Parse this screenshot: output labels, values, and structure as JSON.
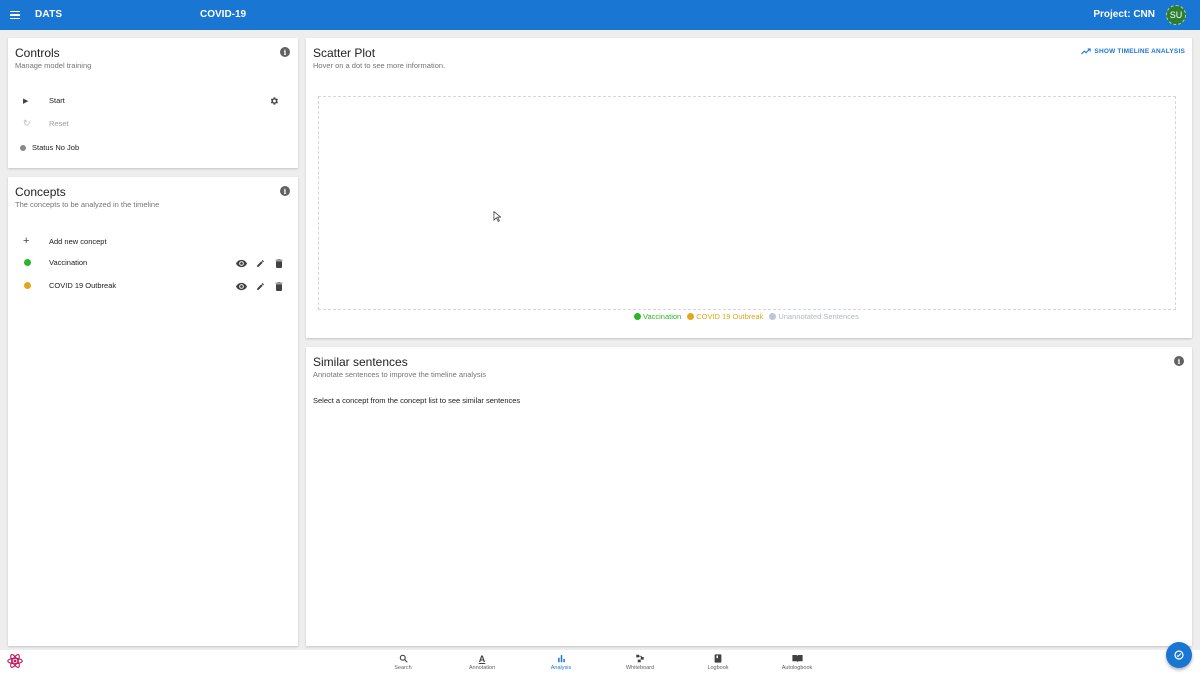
{
  "appbar": {
    "brand": "DATS",
    "page_title": "COVID-19",
    "project": "Project: CNN",
    "avatar": "SU"
  },
  "controls": {
    "title": "Controls",
    "subtitle": "Manage model training",
    "start_label": "Start",
    "reset_label": "Reset",
    "status_label": "Status No Job"
  },
  "concepts": {
    "title": "Concepts",
    "subtitle": "The concepts to be analyzed in the timeline",
    "add_label": "Add new concept",
    "items": [
      {
        "name": "Vaccination",
        "color": "#2bb52b"
      },
      {
        "name": "COVID 19 Outbreak",
        "color": "#e0a81c"
      }
    ]
  },
  "scatter": {
    "title": "Scatter Plot",
    "subtitle": "Hover on a dot to see more information.",
    "timeline_button": "SHOW TIMELINE ANALYSIS",
    "legend": [
      {
        "label": "Vaccination",
        "color": "#2bb52b"
      },
      {
        "label": "COVID 19 Outbreak",
        "color": "#e0a81c"
      },
      {
        "label": "Unannotated Sentences",
        "color": "#bcc7d6"
      }
    ]
  },
  "similar": {
    "title": "Similar sentences",
    "subtitle": "Annotate sentences to improve the timeline analysis",
    "body": "Select a concept from the concept list to see similar sentences"
  },
  "bottom_nav": [
    {
      "label": "Search",
      "icon": "search-icon"
    },
    {
      "label": "Annotation",
      "icon": "annotation-icon"
    },
    {
      "label": "Analysis",
      "icon": "bar-chart-icon",
      "active": true
    },
    {
      "label": "Whiteboard",
      "icon": "whiteboard-icon"
    },
    {
      "label": "Logbook",
      "icon": "book-icon"
    },
    {
      "label": "Autologbook",
      "icon": "open-book-icon"
    }
  ],
  "colors": {
    "primary": "#1976d2",
    "background": "#eeeeee"
  }
}
